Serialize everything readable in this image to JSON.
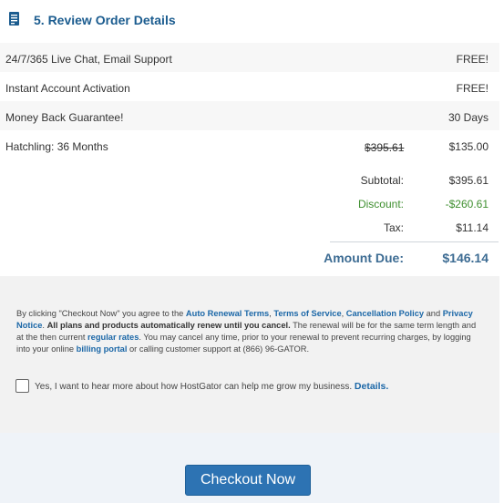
{
  "section": {
    "title": "5. Review Order Details",
    "icon": "receipt-icon"
  },
  "items": [
    {
      "label": "24/7/365 Live Chat, Email Support",
      "value": "FREE!"
    },
    {
      "label": "Instant Account Activation",
      "value": "FREE!"
    },
    {
      "label": "Money Back Guarantee!",
      "value": "30 Days"
    },
    {
      "label": "Hatchling: 36 Months",
      "original_price": "$395.61",
      "value": "$135.00"
    }
  ],
  "totals": {
    "subtotal_label": "Subtotal:",
    "subtotal": "$395.61",
    "discount_label": "Discount:",
    "discount": "-$260.61",
    "tax_label": "Tax:",
    "tax": "$11.14",
    "due_label": "Amount Due:",
    "due": "$146.14"
  },
  "terms": {
    "t1": "By clicking \"Checkout Now\" you agree to the ",
    "link_auto_renewal": "Auto Renewal Terms",
    "t2": ", ",
    "link_tos": "Terms of Service",
    "t3": ", ",
    "link_cancellation": "Cancellation Policy",
    "t4": " and ",
    "link_privacy": "Privacy Notice",
    "t5": ". ",
    "bold_text": "All plans and products automatically renew until you cancel.",
    "t6": " The renewal will be for the same term length and at the then current ",
    "link_regular_rates": "regular rates",
    "t7": ". You may cancel any time, prior to your renewal to prevent recurring charges, by logging into your online ",
    "link_billing_portal": "billing portal",
    "t8": " or calling customer support at (866) 96-GATOR."
  },
  "optin": {
    "label": "Yes, I want to hear more about how HostGator can help me grow my business.",
    "details_link": "Details.",
    "checked": false
  },
  "checkout": {
    "label": "Checkout Now"
  },
  "colors": {
    "accent": "#2d73b3",
    "title": "#1b5c8f",
    "discount": "#3f8f2f",
    "link": "#1b67a7"
  }
}
